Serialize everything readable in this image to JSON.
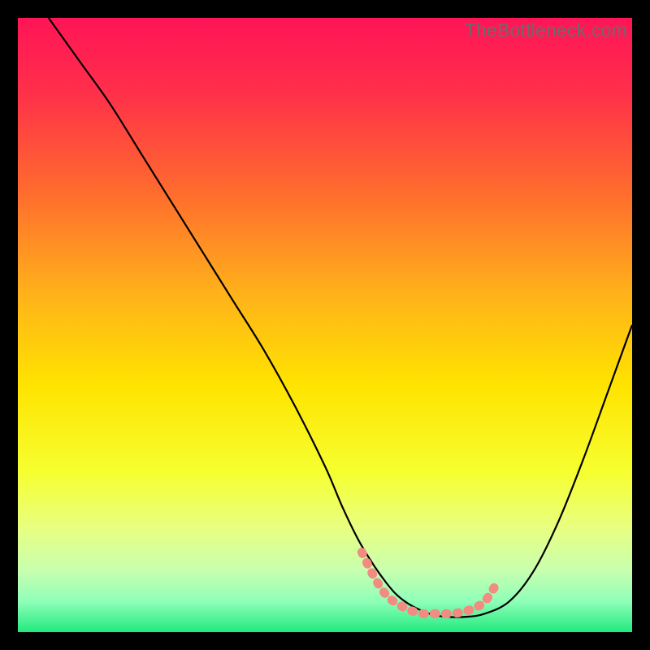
{
  "watermark": "TheBottleneck.com",
  "chart_data": {
    "type": "line",
    "title": "",
    "xlabel": "",
    "ylabel": "",
    "xlim": [
      0,
      100
    ],
    "ylim": [
      0,
      100
    ],
    "grid": false,
    "legend": false,
    "gradient_stops": [
      {
        "offset": 0.0,
        "color": "#ff1457"
      },
      {
        "offset": 0.12,
        "color": "#ff2f4a"
      },
      {
        "offset": 0.28,
        "color": "#ff6a2e"
      },
      {
        "offset": 0.45,
        "color": "#ffb21a"
      },
      {
        "offset": 0.6,
        "color": "#ffe400"
      },
      {
        "offset": 0.74,
        "color": "#f6ff30"
      },
      {
        "offset": 0.83,
        "color": "#e8ff80"
      },
      {
        "offset": 0.9,
        "color": "#c8ffb0"
      },
      {
        "offset": 0.95,
        "color": "#8effb8"
      },
      {
        "offset": 1.0,
        "color": "#22e97d"
      }
    ],
    "series": [
      {
        "name": "bottleneck-curve",
        "color": "#000000",
        "x": [
          5,
          10,
          15,
          20,
          25,
          30,
          35,
          40,
          45,
          50,
          53,
          56,
          60,
          63,
          67,
          70,
          73,
          76,
          80,
          84,
          88,
          92,
          96,
          100
        ],
        "y": [
          100,
          93,
          86,
          78,
          70,
          62,
          54,
          46,
          37,
          27,
          20,
          14,
          8,
          5,
          3,
          2.5,
          2.5,
          3,
          5,
          10,
          18,
          28,
          39,
          50
        ]
      },
      {
        "name": "optimal-range-marker",
        "color": "#f28b82",
        "x": [
          56,
          58,
          60,
          62,
          64,
          66,
          68,
          70,
          72,
          74,
          76,
          78
        ],
        "y": [
          13,
          9,
          6,
          4.5,
          3.5,
          3,
          3,
          3,
          3.2,
          3.8,
          5,
          8
        ]
      }
    ],
    "annotations": []
  }
}
